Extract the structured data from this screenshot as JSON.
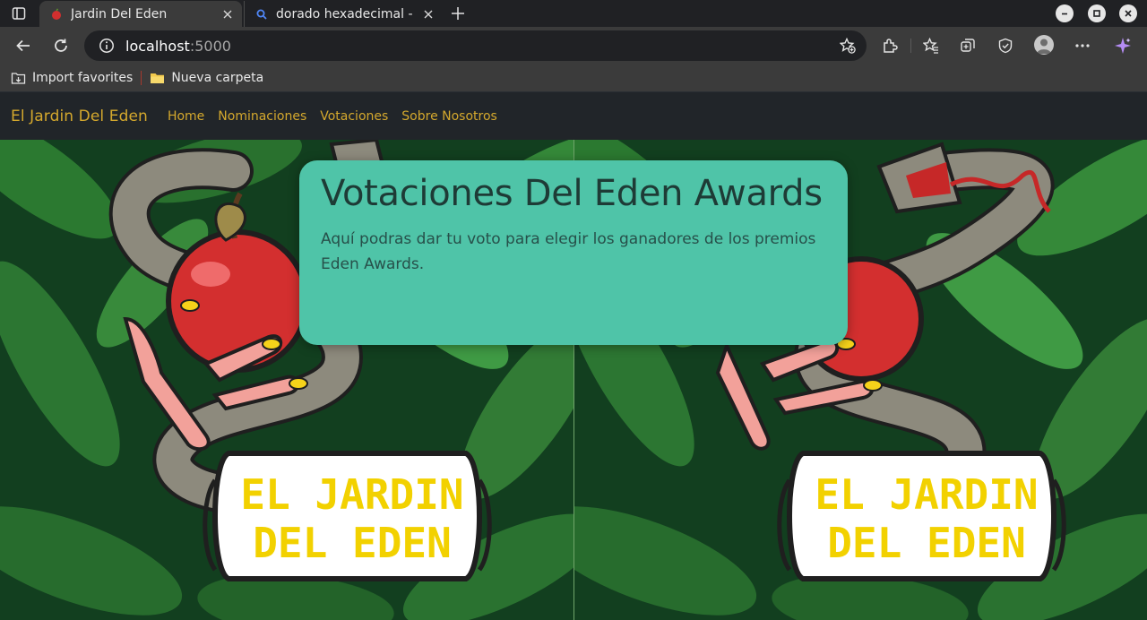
{
  "browser": {
    "tabs": [
      {
        "title": "Jardin Del Eden",
        "active": true,
        "favicon": "apple-favicon"
      },
      {
        "title": "dorado hexadecimal - Bú",
        "active": false,
        "favicon": "search-favicon"
      }
    ],
    "address": {
      "host": "localhost",
      "port": ":5000"
    },
    "bookmarks": [
      {
        "label": "Import favorites",
        "icon": "import-icon"
      },
      {
        "label": "Nueva carpeta",
        "icon": "folder-icon"
      }
    ]
  },
  "navbar": {
    "brand": "El Jardin Del Eden",
    "links": [
      "Home",
      "Nominaciones",
      "Votaciones",
      "Sobre Nosotros"
    ],
    "color": "#d4a82d"
  },
  "hero": {
    "title": "Votaciones Del Eden Awards",
    "subtitle": "Aquí podras dar tu voto para elegir los ganadores de los premios Eden Awards.",
    "background": "#4fc4a8",
    "banner_text_line1": "EL JARDIN",
    "banner_text_line2": "DEL EDEN"
  }
}
